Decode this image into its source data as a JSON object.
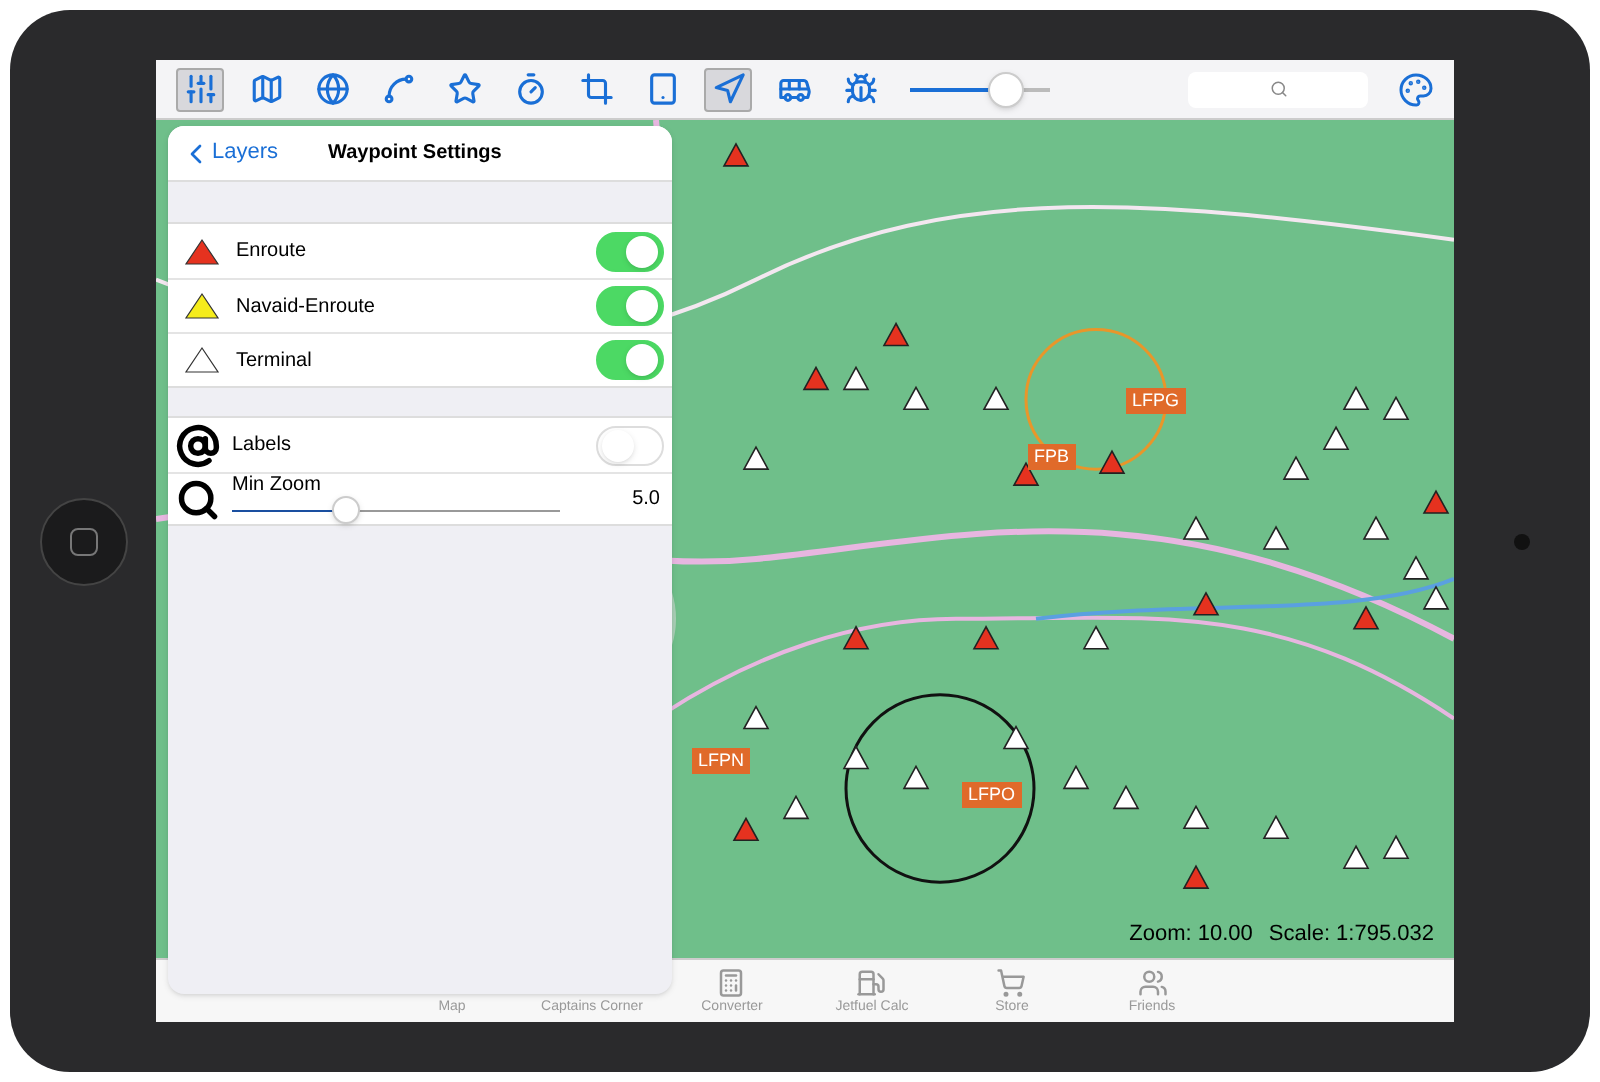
{
  "toolbar": {
    "items": [
      {
        "kind": "sliders",
        "selected": true
      },
      {
        "kind": "map",
        "selected": false
      },
      {
        "kind": "globe",
        "selected": false
      },
      {
        "kind": "route",
        "selected": false
      },
      {
        "kind": "star",
        "selected": false
      },
      {
        "kind": "timer",
        "selected": false
      },
      {
        "kind": "crop",
        "selected": false
      },
      {
        "kind": "tablet",
        "selected": false
      },
      {
        "kind": "locate",
        "selected": true
      },
      {
        "kind": "bus",
        "selected": false
      },
      {
        "kind": "bug",
        "selected": false
      }
    ],
    "slider": {
      "level": 0.68
    },
    "search": {
      "kind": "search"
    }
  },
  "panel": {
    "back": "Layers",
    "title": "Waypoint Settings",
    "waypoint_types": [
      {
        "label": "Enroute",
        "color": "#e5321f",
        "on": true
      },
      {
        "label": "Navaid-Enroute",
        "color": "#f5ec1c",
        "on": true
      },
      {
        "label": "Terminal",
        "color": "#ffffff",
        "on": true
      }
    ],
    "labels": {
      "label": "Labels",
      "on": false
    },
    "min_zoom": {
      "label": "Min Zoom",
      "level": 0.35,
      "reading": "5.0"
    }
  },
  "map": {
    "airports": [
      {
        "code": "LFPG"
      },
      {
        "code": "FPB"
      },
      {
        "code": "LFPO"
      },
      {
        "code": "LFPN"
      }
    ],
    "zoom": "Zoom: 10.00",
    "scale": "Scale: 1:795.032"
  },
  "tab_bar": [
    {
      "label": "Map"
    },
    {
      "label": "Captains Corner"
    },
    {
      "label": "Converter",
      "kind": "calculator"
    },
    {
      "label": "Jetfuel Calc",
      "kind": "fuel"
    },
    {
      "label": "Store",
      "kind": "cart"
    },
    {
      "label": "Friends",
      "kind": "people"
    }
  ]
}
